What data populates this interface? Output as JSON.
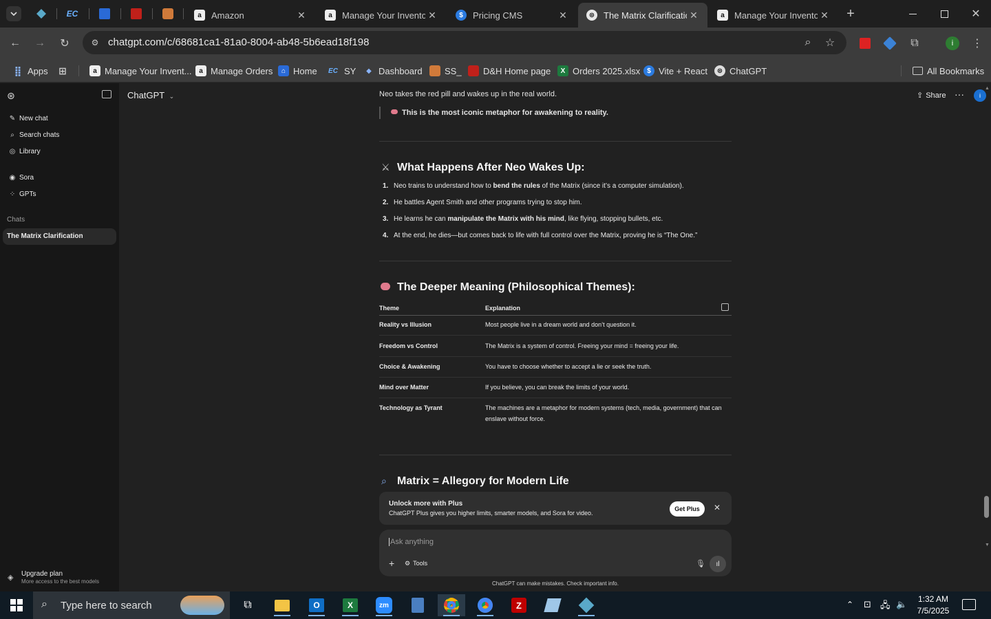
{
  "browser": {
    "tabs": [
      {
        "title": "Amazon",
        "icon": "amazon-icon"
      },
      {
        "title": "Manage Your Inventor",
        "icon": "amazon-icon"
      },
      {
        "title": "Pricing CMS",
        "icon": "dollar-icon"
      },
      {
        "title": "The Matrix Clarificatio",
        "icon": "chatgpt-icon",
        "active": true
      },
      {
        "title": "Manage Your Inventor",
        "icon": "amazon-icon"
      }
    ],
    "url": "chatgpt.com/c/68681ca1-81a0-8004-ab48-5b6ead18f198",
    "bookmarks": [
      {
        "label": "Apps",
        "icon": "apps-grid-icon"
      },
      {
        "label": "Manage Your Invent...",
        "icon": "amazon-icon"
      },
      {
        "label": "Manage Orders",
        "icon": "amazon-icon"
      },
      {
        "label": "Home",
        "icon": "home-icon"
      },
      {
        "label": "SY",
        "icon": "ec-icon"
      },
      {
        "label": "Dashboard",
        "icon": "dashboard-icon"
      },
      {
        "label": "SS_",
        "icon": "ss-icon"
      },
      {
        "label": "D&H Home page",
        "icon": "dh-icon"
      },
      {
        "label": "Orders 2025.xlsx",
        "icon": "excel-icon"
      },
      {
        "label": "Vite + React",
        "icon": "dollar-icon"
      },
      {
        "label": "ChatGPT",
        "icon": "chatgpt-icon"
      }
    ],
    "all_bookmarks": "All Bookmarks",
    "profile_initial": "i"
  },
  "sidebar": {
    "items": [
      {
        "label": "New chat",
        "icon": "edit-icon"
      },
      {
        "label": "Search chats",
        "icon": "search-icon"
      },
      {
        "label": "Library",
        "icon": "library-icon"
      },
      {
        "label": "Sora",
        "icon": "play-circle-icon"
      },
      {
        "label": "GPTs",
        "icon": "grid-icon"
      }
    ],
    "chats_heading": "Chats",
    "chats": [
      {
        "label": "The Matrix Clarification"
      }
    ],
    "upgrade": {
      "title": "Upgrade plan",
      "subtitle": "More access to the best models"
    }
  },
  "header": {
    "model": "ChatGPT",
    "share": "Share",
    "user_initial": "i"
  },
  "conversation": {
    "intro_line": "Neo takes the red pill and wakes up in the real world.",
    "quote": "This is the most iconic metaphor for awakening to reality.",
    "section1": {
      "title": "What Happens After Neo Wakes Up:",
      "items": [
        {
          "num": "1.",
          "pre": "Neo trains to understand how to ",
          "bold": "bend the rules",
          "post": " of the Matrix (since it’s a computer simulation)."
        },
        {
          "num": "2.",
          "pre": "He battles Agent Smith and other programs trying to stop him.",
          "bold": "",
          "post": ""
        },
        {
          "num": "3.",
          "pre": "He learns he can ",
          "bold": "manipulate the Matrix with his mind",
          "post": ", like flying, stopping bullets, etc."
        },
        {
          "num": "4.",
          "pre": "At the end, he dies—but comes back to life with full control over the Matrix, proving he is “The One.”",
          "bold": "",
          "post": ""
        }
      ]
    },
    "section2": {
      "title": "The Deeper Meaning (Philosophical Themes):",
      "columns": [
        "Theme",
        "Explanation"
      ],
      "rows": [
        {
          "theme": "Reality vs Illusion",
          "explanation": "Most people live in a dream world and don’t question it."
        },
        {
          "theme": "Freedom vs Control",
          "explanation": "The Matrix is a system of control. Freeing your mind = freeing your life."
        },
        {
          "theme": "Choice & Awakening",
          "explanation": "You have to choose whether to accept a lie or seek the truth."
        },
        {
          "theme": "Mind over Matter",
          "explanation": "If you believe, you can break the limits of your world."
        },
        {
          "theme": "Technology as Tyrant",
          "explanation": "The machines are a metaphor for modern systems (tech, media, government) that can enslave without force."
        }
      ]
    },
    "section3": {
      "title": "Matrix = Allegory for Modern Life"
    }
  },
  "upsell": {
    "title": "Unlock more with Plus",
    "body": "ChatGPT Plus gives you higher limits, smarter models, and Sora for video.",
    "button": "Get Plus"
  },
  "composer": {
    "placeholder": "Ask anything",
    "tools": "Tools",
    "disclaimer": "ChatGPT can make mistakes. Check important info."
  },
  "taskbar": {
    "search_placeholder": "Type here to search",
    "time": "1:32 AM",
    "date": "7/5/2025"
  }
}
